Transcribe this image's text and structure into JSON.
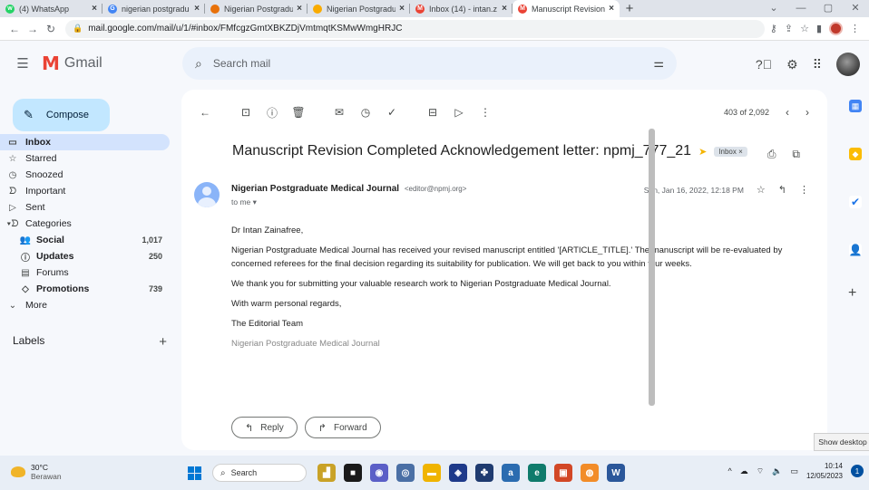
{
  "browser": {
    "tabs": [
      {
        "label": "(4) WhatsApp",
        "color": "#25d366",
        "glyph": "w"
      },
      {
        "label": "nigerian postgradu",
        "color": "#4285f4",
        "glyph": "G"
      },
      {
        "label": "Nigerian Postgradu",
        "color": "#e8710a",
        "glyph": ""
      },
      {
        "label": "Nigerian Postgradu",
        "color": "#f9ab00",
        "glyph": ""
      },
      {
        "label": "Inbox (14) - intan.z",
        "color": "#ea4335",
        "glyph": "M"
      },
      {
        "label": "Manuscript Revision",
        "color": "#ea4335",
        "glyph": "M"
      }
    ],
    "new_tab": "+",
    "url": "mail.google.com/mail/u/1/#inbox/FMfcgzGmtXBKZDjVmtmqtKSMwWmgHRJC"
  },
  "gmail": {
    "wordmark": "Gmail",
    "search_placeholder": "Search mail"
  },
  "sidebar": {
    "compose": "Compose",
    "items": [
      {
        "label": "Inbox",
        "count": "",
        "icon": "▭"
      },
      {
        "label": "Starred",
        "count": "",
        "icon": "☆"
      },
      {
        "label": "Snoozed",
        "count": "",
        "icon": "◷"
      },
      {
        "label": "Important",
        "count": "",
        "icon": "ᗤ"
      },
      {
        "label": "Sent",
        "count": "",
        "icon": "▷"
      },
      {
        "label": "Categories",
        "count": "",
        "icon": "▾ᗤ"
      },
      {
        "label": "Social",
        "count": "1,017",
        "icon": "👥"
      },
      {
        "label": "Updates",
        "count": "250",
        "icon": "ⓘ"
      },
      {
        "label": "Forums",
        "count": "",
        "icon": "▤"
      },
      {
        "label": "Promotions",
        "count": "739",
        "icon": "◇"
      },
      {
        "label": "More",
        "count": "",
        "icon": "⌄"
      }
    ],
    "labels_title": "Labels",
    "labels_add": "+"
  },
  "message": {
    "pager": "403 of 2,092",
    "subject": "Manuscript Revision Completed Acknowledgement letter: npmj_777_21",
    "label_chip": "Inbox ×",
    "sender_name": "Nigerian Postgraduate Medical Journal",
    "sender_email": "<editor@npmj.org>",
    "to": "to me ▾",
    "date": "Sun, Jan 16, 2022, 12:18 PM",
    "greeting": "Dr Intan Zainafree,",
    "paragraph1": "Nigerian Postgraduate Medical Journal has received your revised manuscript entitled '[ARTICLE_TITLE].' The manuscript will be re-evaluated by concerned referees for the final decision regarding its suitability for publication. We will get back to you within four weeks.",
    "paragraph2": "We thank you for submitting your valuable research work to Nigerian Postgraduate Medical Journal.",
    "closing": "With warm personal regards,",
    "team": "The Editorial Team",
    "signature": "Nigerian Postgraduate Medical Journal",
    "reply": "Reply",
    "forward": "Forward"
  },
  "tooltip": "Show desktop",
  "taskbar": {
    "temp": "30°C",
    "weather": "Berawan",
    "search": "Search",
    "time": "10:14",
    "date": "12/05/2023",
    "notifications": "1"
  }
}
